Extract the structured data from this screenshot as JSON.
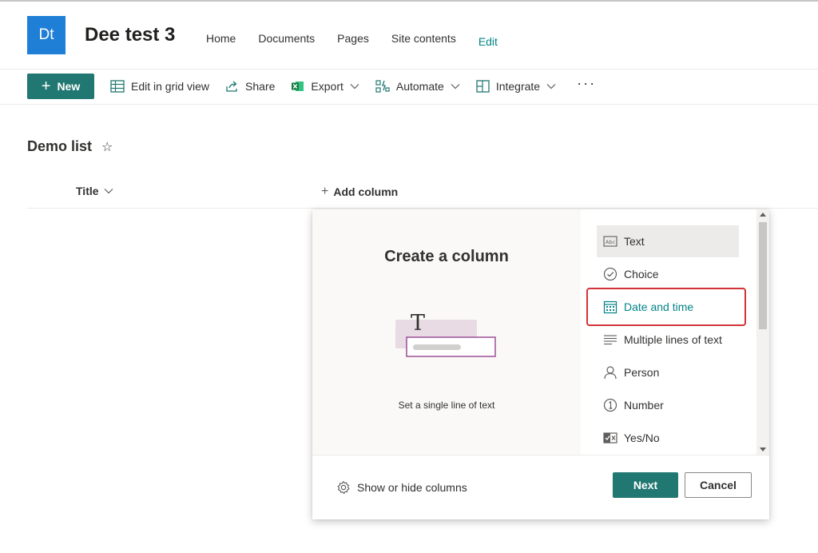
{
  "site": {
    "logo_text": "Dt",
    "title": "Dee test 3",
    "logo_color": "#1f7fd6"
  },
  "nav": {
    "items": [
      "Home",
      "Documents",
      "Pages",
      "Site contents"
    ],
    "edit": "Edit"
  },
  "commands": {
    "new": "New",
    "edit_grid": "Edit in grid view",
    "share": "Share",
    "export": "Export",
    "automate": "Automate",
    "integrate": "Integrate",
    "more": "···"
  },
  "list": {
    "title": "Demo list",
    "col_title": "Title",
    "add_column": "Add column"
  },
  "panel": {
    "title": "Create a column",
    "description": "Set a single line of text",
    "illustration_glyph": "T",
    "types": [
      "Text",
      "Choice",
      "Date and time",
      "Multiple lines of text",
      "Person",
      "Number",
      "Yes/No"
    ],
    "selected_type": "Text",
    "highlighted_type": "Date and time",
    "show_hide": "Show or hide columns",
    "next": "Next",
    "cancel": "Cancel"
  },
  "colors": {
    "accent": "#217771",
    "link": "#038387",
    "highlight_border": "#d13438"
  }
}
